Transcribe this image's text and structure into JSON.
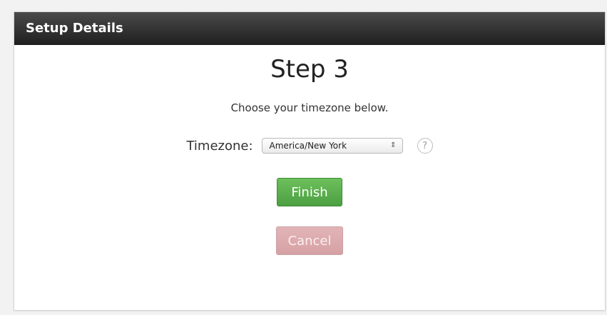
{
  "panel": {
    "title": "Setup Details"
  },
  "step": {
    "title": "Step 3",
    "instruction": "Choose your timezone below."
  },
  "timezone": {
    "label": "Timezone:",
    "selected": "America/New York",
    "arrows": "⇕",
    "help_glyph": "?"
  },
  "buttons": {
    "finish_label": "Finish",
    "cancel_label": "Cancel"
  },
  "colors": {
    "finish": "#5cb050",
    "cancel": "#dcaaad",
    "header": "#2b2b2b"
  }
}
